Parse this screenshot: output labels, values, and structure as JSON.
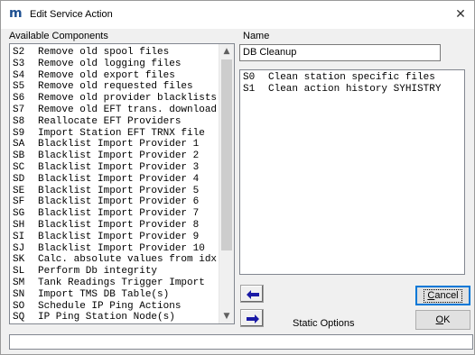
{
  "window": {
    "title": "Edit Service Action",
    "app_icon_glyph": "m",
    "close_glyph": "✕"
  },
  "available_components": {
    "label": "Available Components",
    "items": [
      {
        "code": "S2",
        "text": "Remove old spool files"
      },
      {
        "code": "S3",
        "text": "Remove old logging files"
      },
      {
        "code": "S4",
        "text": "Remove old export files"
      },
      {
        "code": "S5",
        "text": "Remove old requested files"
      },
      {
        "code": "S6",
        "text": "Remove old provider blacklists"
      },
      {
        "code": "S7",
        "text": "Remove old EFT trans. download"
      },
      {
        "code": "S8",
        "text": "Reallocate EFT Providers"
      },
      {
        "code": "S9",
        "text": "Import Station EFT TRNX file"
      },
      {
        "code": "SA",
        "text": "Blacklist Import Provider 1"
      },
      {
        "code": "SB",
        "text": "Blacklist Import Provider 2"
      },
      {
        "code": "SC",
        "text": "Blacklist Import Provider 3"
      },
      {
        "code": "SD",
        "text": "Blacklist Import Provider 4"
      },
      {
        "code": "SE",
        "text": "Blacklist Import Provider 5"
      },
      {
        "code": "SF",
        "text": "Blacklist Import Provider 6"
      },
      {
        "code": "SG",
        "text": "Blacklist Import Provider 7"
      },
      {
        "code": "SH",
        "text": "Blacklist Import Provider 8"
      },
      {
        "code": "SI",
        "text": "Blacklist Import Provider 9"
      },
      {
        "code": "SJ",
        "text": "Blacklist Import Provider 10"
      },
      {
        "code": "SK",
        "text": "Calc. absolute values from idx"
      },
      {
        "code": "SL",
        "text": "Perform Db integrity"
      },
      {
        "code": "SM",
        "text": "Tank Readings Trigger Import"
      },
      {
        "code": "SN",
        "text": "Import TMS DB Table(s)"
      },
      {
        "code": "SO",
        "text": "Schedule IP Ping Actions"
      },
      {
        "code": "SQ",
        "text": "IP Ping Station Node(s)"
      }
    ]
  },
  "name_field": {
    "label": "Name",
    "value": "DB Cleanup"
  },
  "selected_components": {
    "items": [
      {
        "code": "S0",
        "text": "Clean station specific files"
      },
      {
        "code": "S1",
        "text": "Clean action history SYHISTRY"
      }
    ]
  },
  "buttons": {
    "cancel_label": "Cancel",
    "cancel_mnemonic": "C",
    "cancel_rest": "ancel",
    "ok_label": "OK",
    "ok_mnemonic": "O",
    "ok_rest": "K"
  },
  "static_options_label": "Static Options",
  "status_text": "",
  "colors": {
    "arrow_blue": "#1a1aa6",
    "title_icon": "#1d4f91",
    "focus_border": "#0078d7"
  }
}
